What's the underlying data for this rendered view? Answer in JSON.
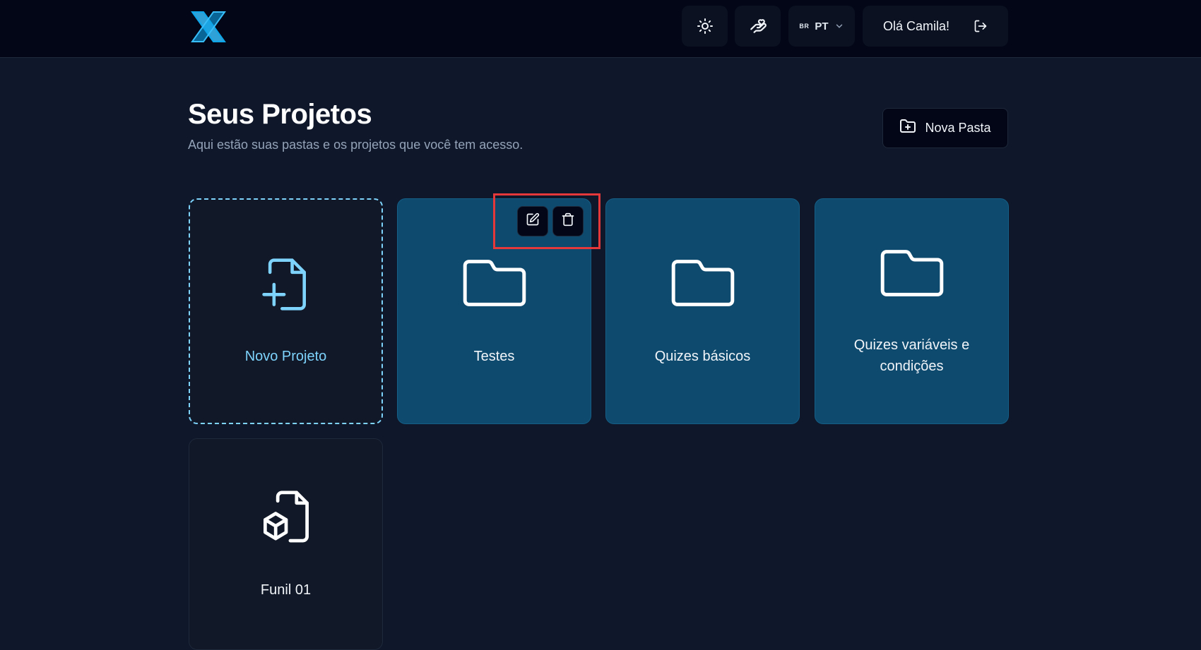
{
  "header": {
    "logo": "X",
    "language": {
      "flag": "BR",
      "label": "PT"
    },
    "greeting": "Olá Camila!"
  },
  "page": {
    "title": "Seus Projetos",
    "subtitle": "Aqui estão suas pastas e os projetos que você tem acesso.",
    "new_folder_label": "Nova Pasta"
  },
  "cards": {
    "new_project": "Novo Projeto",
    "folders": [
      "Testes",
      "Quizes básicos",
      "Quizes variáveis e condições"
    ],
    "projects": [
      "Funil 01"
    ]
  },
  "colors": {
    "background": "#0f172a",
    "topbar": "#020617",
    "folder_card": "#0e4a6e",
    "accent": "#7dd3fc",
    "highlight": "#e5383b"
  }
}
